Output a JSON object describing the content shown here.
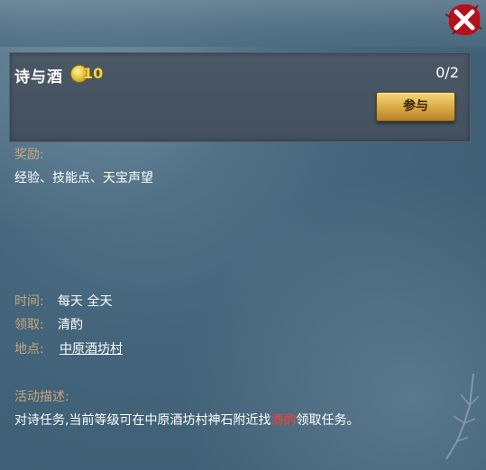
{
  "quest": {
    "title": "诗与酒",
    "coin_value": "10",
    "progress": "0/2",
    "join_label": "参与"
  },
  "reward": {
    "label": "奖励:",
    "value": "经验、技能点、天宝声望"
  },
  "time": {
    "label": "时间:",
    "value": "每天 全天"
  },
  "receive": {
    "label": "领取:",
    "value": "清酌"
  },
  "location": {
    "label": "地点:",
    "value": "中原酒坊村"
  },
  "description": {
    "label": "活动描述:",
    "part1": "对诗任务,当前等级可在中原酒坊村神石附近找",
    "highlight": "清酌",
    "part2": "领取任务。"
  },
  "icons": {
    "close": "close-icon",
    "coin": "coin-icon"
  },
  "colors": {
    "label": "#c7a77d",
    "highlight": "#ff3b2f",
    "coin": "#f3d54a"
  }
}
